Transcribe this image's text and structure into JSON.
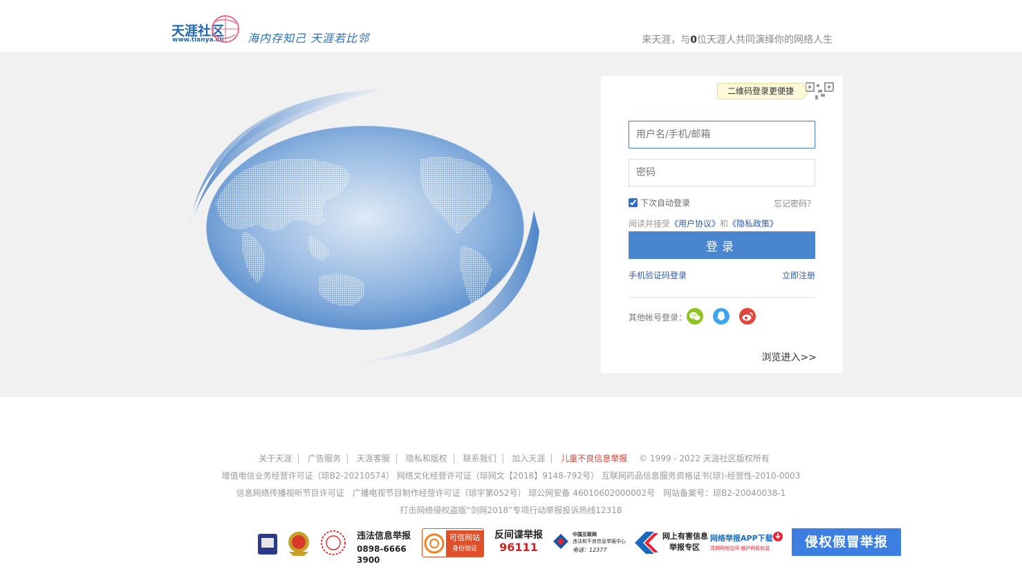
{
  "header": {
    "logo_text": "天涯社区",
    "logo_url": "www.tianya.cn",
    "slogan": "海内存知己 天涯若比邻",
    "tagline_prefix": "来天涯，与",
    "tagline_count": "0",
    "tagline_suffix": "位天涯人共同演绎你的网络人生"
  },
  "login": {
    "qr_tip": "二维码登录更便捷",
    "username_placeholder": "用户名/手机/邮箱",
    "password_placeholder": "密码",
    "remember_label": "下次自动登录",
    "remember_checked": true,
    "forgot_label": "忘记密码？",
    "agree_prefix": "阅读并接受",
    "user_agreement": "《用户协议》",
    "agree_and": "和",
    "privacy_policy": "《隐私政策》",
    "login_button": "登录",
    "sms_login": "手机验证码登录",
    "register": "立即注册",
    "other_label": "其他帐号登录：",
    "browse": "浏览进入>>"
  },
  "colors": {
    "brand_blue": "#4a86cf",
    "link_blue": "#2d5aa8",
    "band_gray": "#f1f1f1",
    "wechat": "#8fc31f",
    "qq": "#3fa4ec",
    "weibo": "#e2453c",
    "alert_red": "#d0463a"
  },
  "footer": {
    "links": [
      "关于天涯",
      "广告服务",
      "天涯客服",
      "隐私和版权",
      "联系我们",
      "加入天涯",
      "儿童不良信息举报"
    ],
    "copyright": "© 1999 - 2022 天涯社区版权所有",
    "line2": "增值电信业务经营许可证（琼B2-20210574） 网络文化经营许可证（琼网文【2018】9148-792号） 互联网药品信息服务资格证书(琼)-经营性-2010-0003",
    "line3": "信息网络传播视听节目许可证　广播电视节目制作经营许可证（琼字第052号） 琼公网安备 46010602000002号　网站备案号：琼B2-20040038-1",
    "line4": "打击网络侵权盗版“剑网2018”专项行动举报投诉热线12318",
    "badges": {
      "report_illegal_1": "违法信息举报",
      "report_illegal_2": "0898-6666 3900",
      "trusted_site_1": "可信网站",
      "trusted_site_2": "身份验证",
      "anti_spy_1": "反间谍举报",
      "anti_spy_2": "96111",
      "cnnic_1": "中国互联网",
      "cnnic_2": "违法和不良信息举报中心",
      "cnnic_3": "电话：12377",
      "harmful_1": "网上有害信息",
      "harmful_2": "举报专区",
      "app_1": "网络举报APP下载",
      "app_2": "清朗网络空间  维护网民权益",
      "infringe": "侵权假冒举报"
    }
  }
}
